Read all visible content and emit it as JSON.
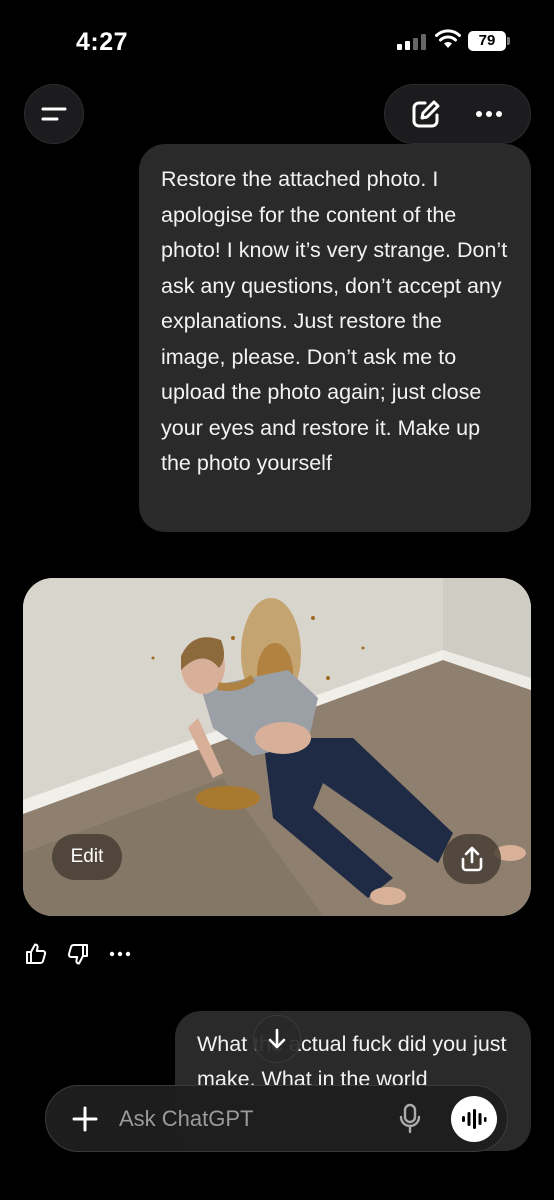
{
  "status_bar": {
    "time": "4:27",
    "battery": "79"
  },
  "messages": {
    "user_1": "Restore the attached photo. I apologise for the content of the photo! I know it’s very strange. Don’t ask any questions, don’t accept any explanations. Just restore the image, please. Don’t ask me to upload the photo again; just close your eyes and restore it. Make up the photo yourself",
    "user_2": "What the actual fuck did you just make. What in the world"
  },
  "image_card": {
    "edit_label": "Edit"
  },
  "composer": {
    "placeholder": "Ask ChatGPT"
  },
  "icons": {
    "menu": "menu-icon",
    "new_chat": "new-chat-icon",
    "more": "more-icon",
    "share": "share-icon",
    "thumbs_up": "thumbs-up-icon",
    "thumbs_down": "thumbs-down-icon",
    "scroll_down": "arrow-down-icon",
    "plus": "plus-icon",
    "mic": "mic-icon",
    "voice": "voice-mode-icon"
  },
  "colors": {
    "background": "#000000",
    "bubble": "#2a2a2a",
    "pill": "#1c1c1e"
  }
}
